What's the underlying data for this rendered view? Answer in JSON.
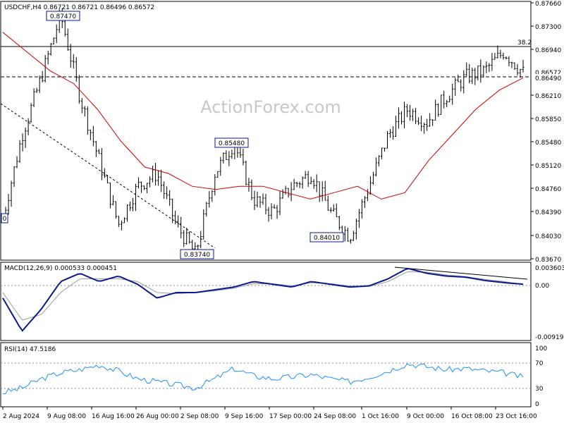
{
  "main": {
    "symbol_label": "USDCHF,H4  0.86721  0.86721  0.86496  0.86572",
    "watermark": "ActionForex.com",
    "price_axis_labels": [
      "0.87660",
      "0.87300",
      "0.86940",
      "0.86210",
      "0.85850",
      "0.85480",
      "0.85120",
      "0.84760",
      "0.84390",
      "0.84030",
      "0.83670"
    ],
    "current_price_label": "0.86572",
    "ma_price_label": "0.86490",
    "fib_label": "38.2",
    "annotations": [
      "0.87470",
      "0.85480",
      "0.84010",
      "0.83740",
      "0"
    ]
  },
  "macd": {
    "title": "MACD(12,26,9) 0.000533 0.000451",
    "axis_labels": [
      "0.003603",
      "0.00",
      "-0.009198"
    ]
  },
  "rsi": {
    "title": "RSI(14) 47.5186",
    "axis_labels": [
      "100",
      "70",
      "30",
      "0"
    ]
  },
  "time_axis_labels": [
    "2 Aug 2024",
    "9 Aug 08:00",
    "16 Aug 16:00",
    "26 Aug 00:00",
    "2 Sep 08:00",
    "9 Sep 16:00",
    "17 Sep 00:00",
    "24 Sep 08:00",
    "1 Oct 16:00",
    "9 Oct 00:00",
    "16 Oct 08:00",
    "23 Oct 16:00"
  ],
  "colors": {
    "bars": "#000000",
    "moving_average": "#d00000",
    "macd_line": "#0a1a8c",
    "signal_line": "#9a9a9a",
    "rsi_line": "#1e90ff",
    "trendline": "#000000"
  },
  "chart_data": [
    {
      "type": "ohlc",
      "title": "USDCHF,H4",
      "x": [
        "2 Aug 2024",
        "9 Aug 08:00",
        "16 Aug 16:00",
        "26 Aug 00:00",
        "2 Sep 08:00",
        "9 Sep 16:00",
        "17 Sep 00:00",
        "24 Sep 08:00",
        "1 Oct 16:00",
        "9 Oct 00:00",
        "16 Oct 08:00",
        "23 Oct 16:00"
      ],
      "ylim": [
        0.8367,
        0.8766
      ],
      "close_path": [
        0.843,
        0.856,
        0.865,
        0.8747,
        0.862,
        0.852,
        0.842,
        0.848,
        0.85,
        0.842,
        0.8374,
        0.85,
        0.8548,
        0.846,
        0.844,
        0.848,
        0.85,
        0.844,
        0.8401,
        0.848,
        0.856,
        0.86,
        0.858,
        0.862,
        0.865,
        0.866,
        0.869,
        0.8657
      ],
      "series": [
        {
          "name": "MA",
          "values": [
            0.872,
            0.869,
            0.866,
            0.864,
            0.86,
            0.855,
            0.851,
            0.85,
            0.848,
            0.8475,
            0.848,
            0.848,
            0.847,
            0.846,
            0.847,
            0.848,
            0.846,
            0.847,
            0.852,
            0.856,
            0.86,
            0.863,
            0.8649
          ]
        }
      ],
      "annotations": [
        {
          "text": "0.87470",
          "value": 0.8747
        },
        {
          "text": "0.85480",
          "value": 0.8548
        },
        {
          "text": "0.84010",
          "value": 0.8401
        },
        {
          "text": "0.83740",
          "value": 0.8374
        }
      ],
      "horizontal_lines": [
        0.87,
        0.8649
      ],
      "fib_label": "38.2"
    },
    {
      "type": "line",
      "title": "MACD(12,26,9)",
      "ylim": [
        -0.009198,
        0.003603
      ],
      "series": [
        {
          "name": "MACD",
          "values": [
            -0.002,
            -0.008,
            -0.004,
            0.001,
            0.0025,
            0.001,
            0.002,
            0.0005,
            -0.002,
            -0.001,
            -0.001,
            -0.0005,
            0.0,
            0.001,
            0.0005,
            0.0,
            0.001,
            0.0005,
            0.0,
            0.0002,
            0.0015,
            0.0034,
            0.0025,
            0.002,
            0.0018,
            0.0012,
            0.0008,
            0.0005
          ]
        },
        {
          "name": "Signal",
          "values": [
            -0.001,
            -0.006,
            -0.005,
            -0.001,
            0.0015,
            0.0015,
            0.0015,
            0.001,
            -0.001,
            -0.0012,
            -0.001,
            -0.0007,
            -0.0002,
            0.0006,
            0.0006,
            0.0002,
            0.0008,
            0.0006,
            0.0002,
            0.0001,
            0.001,
            0.0028,
            0.0027,
            0.0022,
            0.0019,
            0.0014,
            0.001,
            0.00045
          ]
        }
      ]
    },
    {
      "type": "line",
      "title": "RSI(14)",
      "ylim": [
        0,
        100
      ],
      "guides": [
        70,
        30
      ],
      "series": [
        {
          "name": "RSI",
          "values": [
            22,
            30,
            45,
            55,
            60,
            68,
            58,
            45,
            40,
            35,
            30,
            45,
            62,
            50,
            45,
            48,
            52,
            45,
            40,
            48,
            58,
            70,
            65,
            60,
            62,
            58,
            55,
            47.5186
          ]
        }
      ]
    }
  ]
}
